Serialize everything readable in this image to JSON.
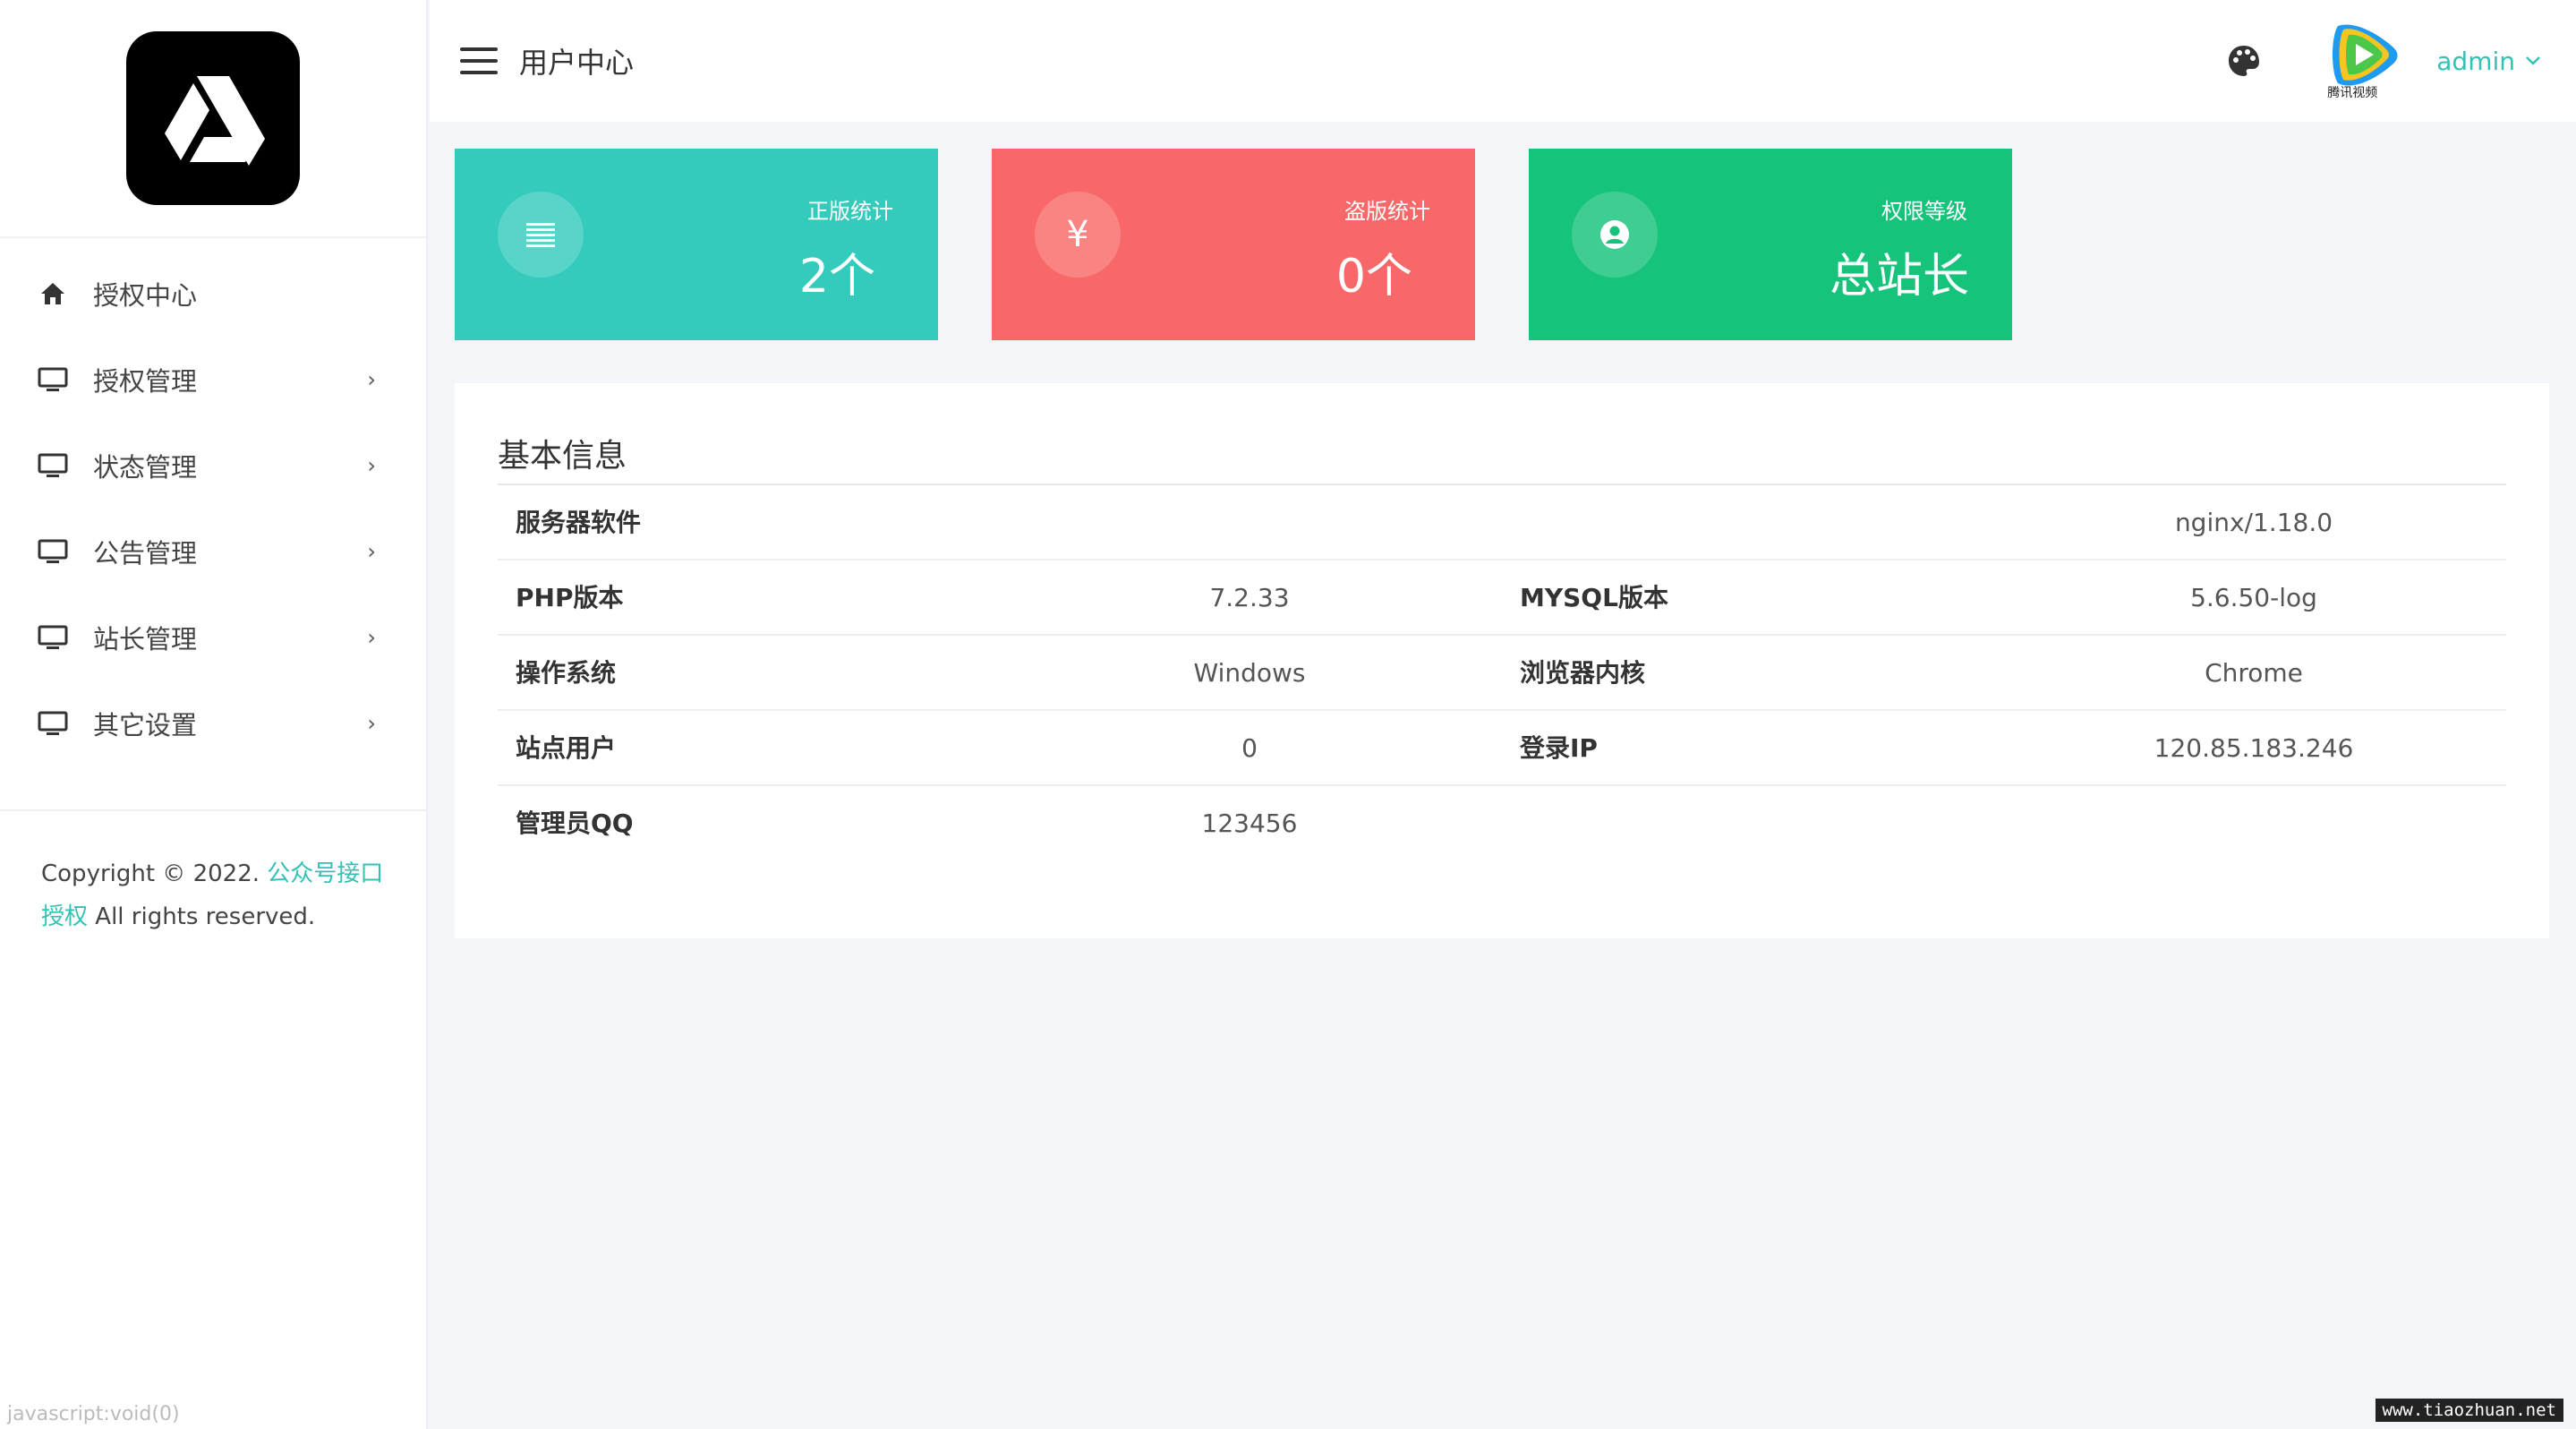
{
  "header": {
    "title": "用户中心",
    "user_name": "admin",
    "avatar_caption": "腾讯视频"
  },
  "sidebar": {
    "items": [
      {
        "label": "授权中心",
        "icon": "home-icon",
        "has_children": false
      },
      {
        "label": "授权管理",
        "icon": "monitor-icon",
        "has_children": true
      },
      {
        "label": "状态管理",
        "icon": "monitor-icon",
        "has_children": true
      },
      {
        "label": "公告管理",
        "icon": "monitor-icon",
        "has_children": true
      },
      {
        "label": "站长管理",
        "icon": "monitor-icon",
        "has_children": true
      },
      {
        "label": "其它设置",
        "icon": "monitor-icon",
        "has_children": true
      }
    ],
    "chevron": "›",
    "copyright_prefix": "Copyright © 2022. ",
    "copyright_link": "公众号接口授权",
    "copyright_suffix": " All rights reserved."
  },
  "status_bar": {
    "url": "javascript:void(0)"
  },
  "cards": [
    {
      "label": "正版统计",
      "value": "2个",
      "icon": "list-icon",
      "color": "#34cbbc"
    },
    {
      "label": "盗版统计",
      "value": "0个",
      "icon": "yen-icon",
      "icon_glyph": "¥",
      "color": "#f96868"
    },
    {
      "label": "权限等级",
      "value": "总站长",
      "icon": "user-circle-icon",
      "color": "#16c37a"
    }
  ],
  "info": {
    "title": "基本信息",
    "server_software_label": "服务器软件",
    "server_software_value": "nginx/1.18.0",
    "php_label": "PHP版本",
    "php_value": "7.2.33",
    "mysql_label": "MYSQL版本",
    "mysql_value": "5.6.50-log",
    "os_label": "操作系统",
    "os_value": "Windows",
    "browser_label": "浏览器内核",
    "browser_value": "Chrome",
    "site_users_label": "站点用户",
    "site_users_value": "0",
    "login_ip_label": "登录IP",
    "login_ip_value": "120.85.183.246",
    "admin_qq_label": "管理员QQ",
    "admin_qq_value": "123456"
  },
  "watermark": "www.tiaozhuan.net",
  "colors": {
    "accent": "#33c2b5",
    "card_teal": "#34cbbc",
    "card_red": "#f96868",
    "card_green": "#16c37a"
  }
}
